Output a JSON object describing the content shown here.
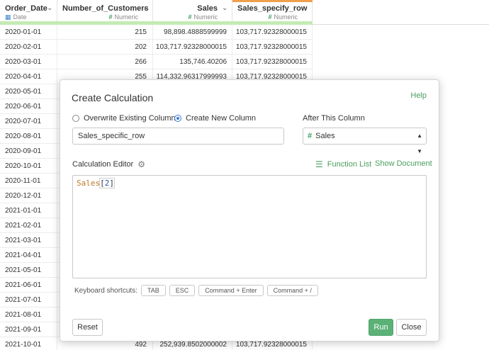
{
  "grid": {
    "columns": [
      {
        "name": "Order_Date",
        "type": "Date",
        "type_icon": "calendar-icon"
      },
      {
        "name": "Number_of_Customers",
        "type": "Numeric",
        "type_icon": "hash-icon"
      },
      {
        "name": "Sales",
        "type": "Numeric",
        "type_icon": "hash-icon"
      },
      {
        "name": "Sales_specify_row",
        "type": "Numeric",
        "type_icon": "hash-icon"
      }
    ],
    "rows": [
      [
        "2020-01-01",
        "215",
        "98,898.4888599999",
        "103,717.92328000015"
      ],
      [
        "2020-02-01",
        "202",
        "103,717.92328000015",
        "103,717.92328000015"
      ],
      [
        "2020-03-01",
        "266",
        "135,746.40206",
        "103,717.92328000015"
      ],
      [
        "2020-04-01",
        "255",
        "114,332.96317999993",
        "103,717.92328000015"
      ],
      [
        "2020-05-01",
        "",
        "",
        ""
      ],
      [
        "2020-06-01",
        "",
        "",
        ""
      ],
      [
        "2020-07-01",
        "",
        "",
        ""
      ],
      [
        "2020-08-01",
        "",
        "",
        ""
      ],
      [
        "2020-09-01",
        "",
        "",
        ""
      ],
      [
        "2020-10-01",
        "",
        "",
        ""
      ],
      [
        "2020-11-01",
        "",
        "",
        ""
      ],
      [
        "2020-12-01",
        "",
        "",
        ""
      ],
      [
        "2021-01-01",
        "",
        "",
        ""
      ],
      [
        "2021-02-01",
        "",
        "",
        ""
      ],
      [
        "2021-03-01",
        "",
        "",
        ""
      ],
      [
        "2021-04-01",
        "",
        "",
        ""
      ],
      [
        "2021-05-01",
        "",
        "",
        ""
      ],
      [
        "2021-06-01",
        "",
        "",
        ""
      ],
      [
        "2021-07-01",
        "",
        "",
        ""
      ],
      [
        "2021-08-01",
        "",
        "",
        ""
      ],
      [
        "2021-09-01",
        "",
        "",
        ""
      ],
      [
        "2021-10-01",
        "492",
        "252,939.8502000002",
        "103,717.92328000015"
      ]
    ]
  },
  "dialog": {
    "title": "Create Calculation",
    "help_label": "Help",
    "radio_overwrite": "Overwrite Existing Column",
    "radio_create": "Create New Column",
    "radio_selected": "create",
    "after_column_label": "After This Column",
    "new_column_name": "Sales_specific_row",
    "after_column_value": "Sales",
    "editor_label": "Calculation Editor",
    "function_list_label": "Function List",
    "show_document_label": "Show Document",
    "code": {
      "column": "Sales",
      "open": "[",
      "index": "2",
      "close": "]"
    },
    "shortcuts_label": "Keyboard shortcuts:",
    "shortcuts": [
      "TAB",
      "ESC",
      "Command + Enter",
      "Command + /"
    ],
    "reset_label": "Reset",
    "run_label": "Run",
    "close_label": "Close"
  },
  "colors": {
    "accent_green": "#4a9e5c",
    "run_button": "#5cb176",
    "radio_selected": "#3a7bd5",
    "active_column_top": "#f0a04b",
    "header_highlight": "#c4ebb3"
  }
}
